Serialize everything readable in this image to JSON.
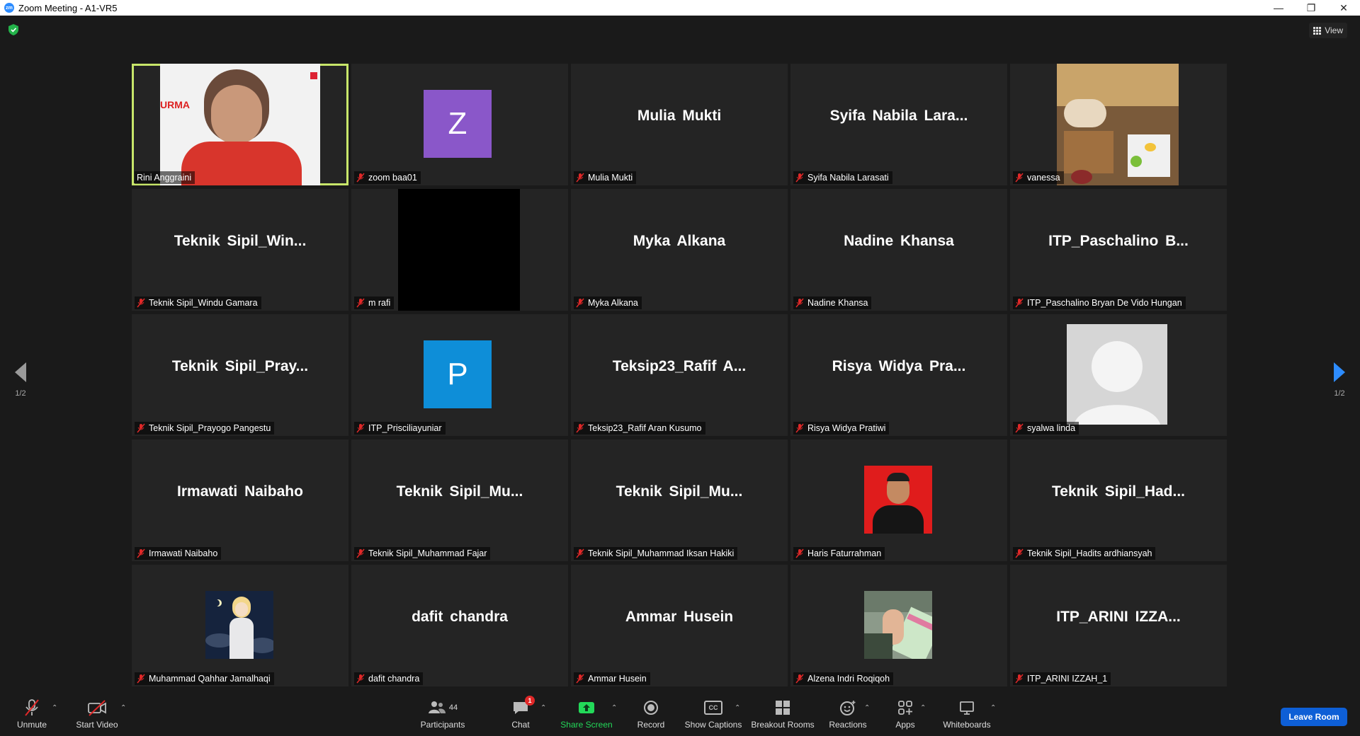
{
  "window": {
    "title": "Zoom Meeting - A1-VR5",
    "app_icon": "zm"
  },
  "top": {
    "view_label": "View"
  },
  "pagination": {
    "left_page": "1/2",
    "right_page": "1/2"
  },
  "tiles": [
    {
      "big_name": "",
      "label": "Rini Anggraini",
      "active": true,
      "muted": false
    },
    {
      "big_name": "",
      "label": "zoom baa01",
      "avatar_letter": "Z",
      "avatar_color": "#8a57c9"
    },
    {
      "big_name": "Mulia Mukti",
      "label": "Mulia Mukti"
    },
    {
      "big_name": "Syifa  Nabila  Lara...",
      "label": "Syifa Nabila Larasati"
    },
    {
      "big_name": "",
      "label": "vanessa"
    },
    {
      "big_name": "Teknik  Sipil_Win...",
      "label": "Teknik Sipil_Windu Gamara"
    },
    {
      "big_name": "",
      "label": "m rafi"
    },
    {
      "big_name": "Myka Alkana",
      "label": "Myka Alkana"
    },
    {
      "big_name": "Nadine Khansa",
      "label": "Nadine Khansa"
    },
    {
      "big_name": "ITP_Paschalino  B...",
      "label": "ITP_Paschalino Bryan De Vido Hungan"
    },
    {
      "big_name": "Teknik  Sipil_Pray...",
      "label": "Teknik Sipil_Prayogo Pangestu"
    },
    {
      "big_name": "",
      "label": "ITP_Prisciliayuniar",
      "avatar_letter": "P",
      "avatar_color": "#0e8ed8"
    },
    {
      "big_name": "Teksip23_Rafif  A...",
      "label": "Teksip23_Rafif Aran Kusumo"
    },
    {
      "big_name": "Risya  Widya  Pra...",
      "label": "Risya Widya Pratiwi"
    },
    {
      "big_name": "",
      "label": "syalwa linda"
    },
    {
      "big_name": "Irmawati Naibaho",
      "label": "Irmawati Naibaho"
    },
    {
      "big_name": "Teknik  Sipil_Mu...",
      "label": "Teknik Sipil_Muhammad Fajar"
    },
    {
      "big_name": "Teknik  Sipil_Mu...",
      "label": "Teknik Sipil_Muhammad Iksan Hakiki"
    },
    {
      "big_name": "",
      "label": "Haris Faturrahman"
    },
    {
      "big_name": "Teknik  Sipil_Had...",
      "label": "Teknik Sipil_Hadits ardhiansyah"
    },
    {
      "big_name": "",
      "label": "Muhammad Qahhar Jamalhaqi"
    },
    {
      "big_name": "dafit chandra",
      "label": "dafit chandra"
    },
    {
      "big_name": "Ammar Husein",
      "label": "Ammar Husein"
    },
    {
      "big_name": "",
      "label": "Alzena Indri Roqiqoh"
    },
    {
      "big_name": "ITP_ARINI  IZZA...",
      "label": "ITP_ARINI IZZAH_1"
    }
  ],
  "toolbar": {
    "unmute": "Unmute",
    "start_video": "Start Video",
    "participants": "Participants",
    "participants_count": "44",
    "chat": "Chat",
    "chat_badge": "1",
    "share_screen": "Share Screen",
    "record": "Record",
    "show_captions": "Show Captions",
    "cc_glyph": "CC",
    "breakout_rooms": "Breakout Rooms",
    "reactions": "Reactions",
    "apps": "Apps",
    "whiteboards": "Whiteboards",
    "leave_room": "Leave Room"
  },
  "colors": {
    "accent_blue": "#2d8cff",
    "active_border": "#c8e66a",
    "mute_red": "#e02828",
    "share_green": "#23d959",
    "leave_blue": "#0e5fd6"
  },
  "icons": {
    "mic_off": "mic-off-icon",
    "video_off": "video-off-icon",
    "participants": "participants-icon",
    "chat": "chat-icon",
    "share": "share-screen-icon",
    "record": "record-icon",
    "captions": "captions-icon",
    "breakout": "breakout-rooms-icon",
    "reactions": "reactions-icon",
    "apps": "apps-icon",
    "whiteboards": "whiteboards-icon"
  }
}
